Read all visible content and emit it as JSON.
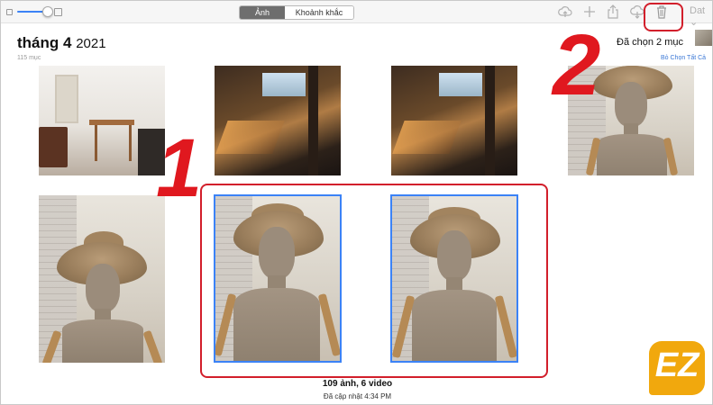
{
  "toolbar": {
    "tabs": [
      {
        "label": "Ảnh",
        "active": true
      },
      {
        "label": "Khoảnh khắc",
        "active": false
      }
    ],
    "icons": [
      "cloud-upload-icon",
      "add-icon",
      "share-icon",
      "cloud-download-icon",
      "trash-icon"
    ],
    "user_label": "Dat"
  },
  "header": {
    "month": "tháng 4",
    "year": "2021",
    "count": "115 mục",
    "selected": "Đã chọn 2 mục",
    "deselect_all": "Bỏ Chọn Tất Cả"
  },
  "annotations": {
    "step1": "1",
    "step2": "2",
    "accent_color": "#d21f2b"
  },
  "footer": {
    "summary": "109 ảnh, 6 video",
    "updated": "Đã cập nhật 4:34 PM"
  },
  "logo": {
    "text": "EZ"
  },
  "colors": {
    "selection": "#3b82f6",
    "link": "#3b78d6"
  }
}
